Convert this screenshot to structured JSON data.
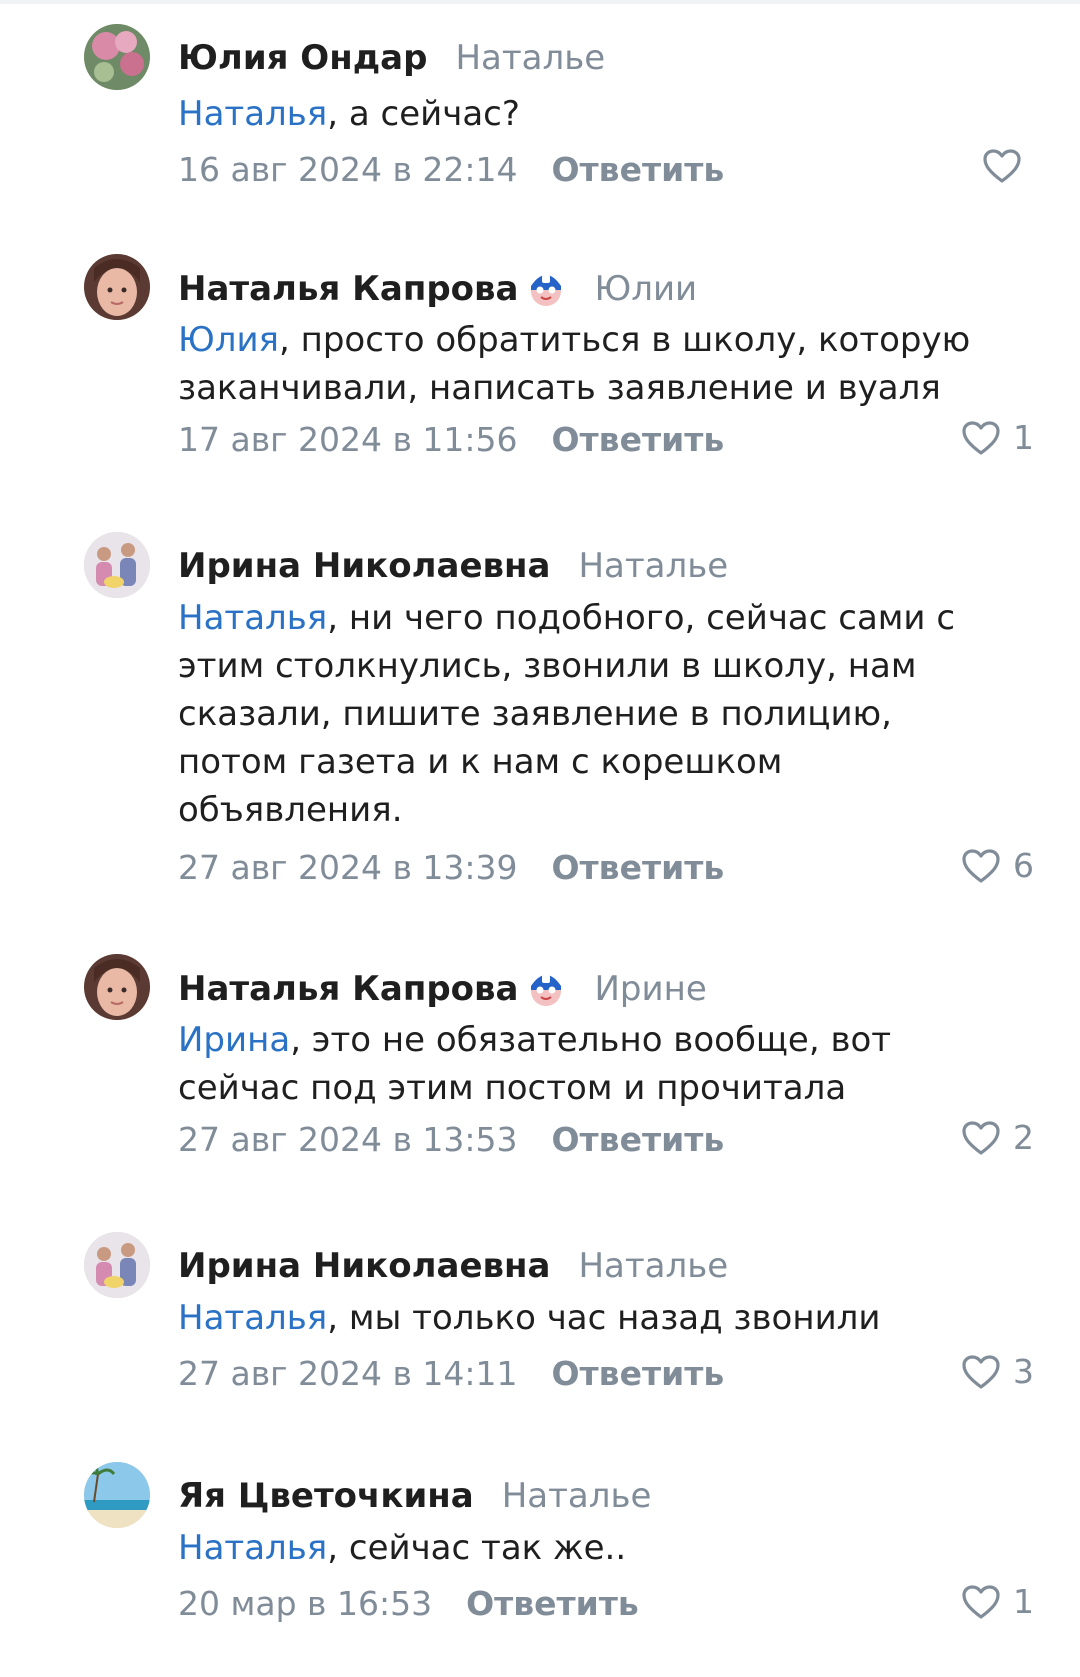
{
  "reply_label": "Ответить",
  "colors": {
    "mention": "#2a72c5",
    "muted": "#818c99",
    "text": "#1f1f1f"
  },
  "comments": [
    {
      "author": "Юлия Ондар",
      "reply_to": "Наталье",
      "mention": "Наталья",
      "text": ", а сейчас?",
      "date": "16 авг 2024 в 22:14",
      "likes": "",
      "badge": false,
      "avatar": "flowers"
    },
    {
      "author": "Наталья Капрова",
      "reply_to": "Юлии",
      "mention": "Юлия",
      "text": ", просто обратиться в школу, которую заканчивали, написать заявление и вуаля",
      "date": "17 авг 2024 в 11:56",
      "likes": "1",
      "badge": true,
      "avatar": "girl"
    },
    {
      "author": "Ирина Николаевна",
      "reply_to": "Наталье",
      "mention": "Наталья",
      "text": ", ни чего подобного, сейчас сами с этим столкнулись, звонили в школу, нам сказали, пишите заявление в полицию, потом газета и к нам с корешком объявления.",
      "date": "27 авг 2024 в 13:39",
      "likes": "6",
      "badge": false,
      "avatar": "family"
    },
    {
      "author": "Наталья Капрова",
      "reply_to": "Ирине",
      "mention": "Ирина",
      "text": ", это не обязательно вообще, вот сейчас под этим постом и прочитала",
      "date": "27 авг 2024 в 13:53",
      "likes": "2",
      "badge": true,
      "avatar": "girl"
    },
    {
      "author": "Ирина Николаевна",
      "reply_to": "Наталье",
      "mention": "Наталья",
      "text": ", мы только час назад звонили",
      "date": "27 авг 2024 в 14:11",
      "likes": "3",
      "badge": false,
      "avatar": "family"
    },
    {
      "author": "Яя Цветочкина",
      "reply_to": "Наталье",
      "mention": "Наталья",
      "text": ", сейчас так же..",
      "date": "20 мар в 16:53",
      "likes": "1",
      "badge": false,
      "avatar": "beach"
    }
  ]
}
